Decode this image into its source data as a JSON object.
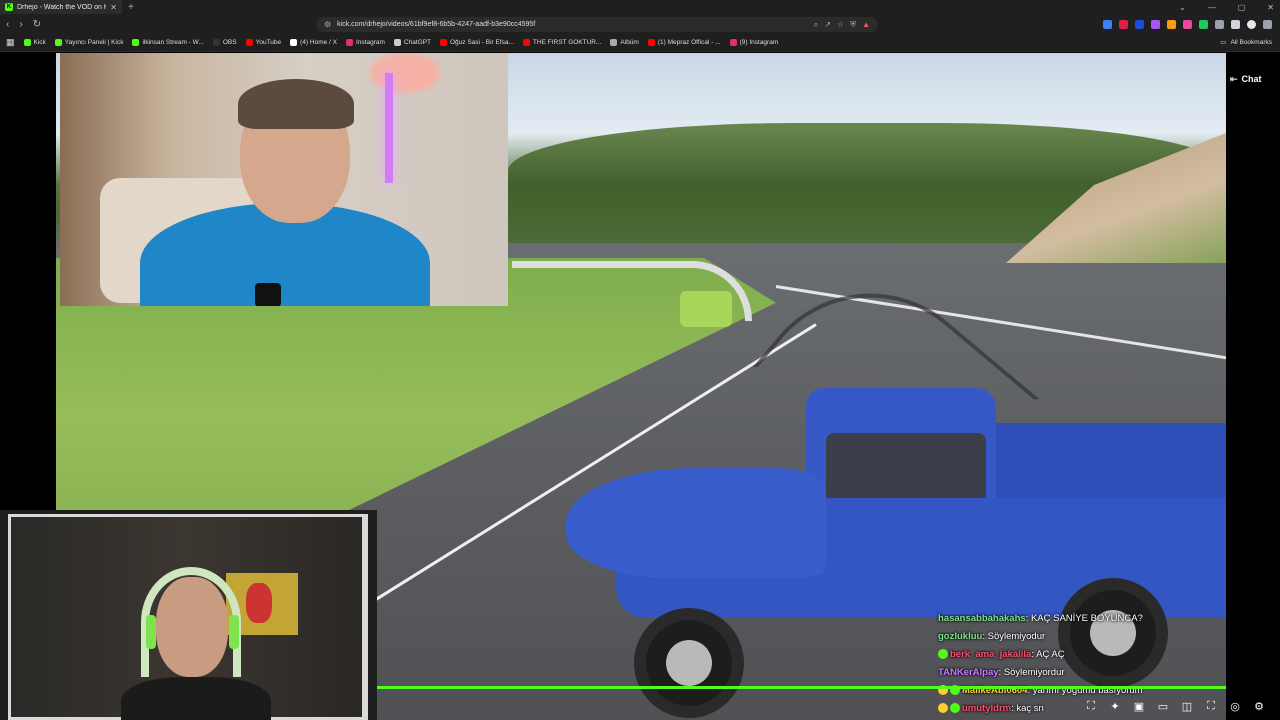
{
  "browser": {
    "tab_title": "Drhejo - Watch the VOD on Kick",
    "tab_favicon": "K",
    "url": "kick.com/drhejo/videos/61bf9ef8-6b5b-4247-aadf-b3e90cc4595f",
    "bookmarks": [
      {
        "label": "Kick",
        "color": "#53fc18"
      },
      {
        "label": "Yayıncı Paneli | Kick",
        "color": "#53fc18"
      },
      {
        "label": "ilkinsan Stream - W...",
        "color": "#53fc18"
      },
      {
        "label": "OBS",
        "color": "#333333"
      },
      {
        "label": "YouTube",
        "color": "#ff0000"
      },
      {
        "label": "(4) Home / X",
        "color": "#ffffff"
      },
      {
        "label": "Instagram",
        "color": "#e1306c"
      },
      {
        "label": "ChatGPT",
        "color": "#cccccc"
      },
      {
        "label": "Oğuz Sasi - Bir Efsa...",
        "color": "#ff0000"
      },
      {
        "label": "THE FIRST GOKTUR...",
        "color": "#ff0000"
      },
      {
        "label": "Albüm",
        "color": "#aaaaaa"
      },
      {
        "label": "(1) Mepraz Offical - ...",
        "color": "#ff0000"
      },
      {
        "label": "(9) Instagram",
        "color": "#e1306c"
      }
    ],
    "all_bookmarks_label": "All Bookmarks"
  },
  "player": {
    "chat_button_label": "Chat",
    "progress_fraction": 1.0,
    "accent": "#53fc18"
  },
  "chat": [
    {
      "user": "hasansabbahakahs",
      "user_color": "#7fe08a",
      "text": "KAÇ SANİYE BOYUNCA?",
      "badge": ""
    },
    {
      "user": "gozlukluu",
      "user_color": "#7fe08a",
      "text": "Söylemiyodur",
      "badge": ""
    },
    {
      "user": "berk_ama_jakalila",
      "user_color": "#ff4d6d",
      "text": "AÇ AÇ",
      "badge": "#53fc18"
    },
    {
      "user": "TANKerAlpay",
      "user_color": "#c77dff",
      "text": "Söylemiyordur",
      "badge": ""
    },
    {
      "user": "MalikeAbi0604",
      "user_color": "#ffcc33",
      "text": "yarımı yoğumu basıyorum",
      "badge": "#ffcc33"
    },
    {
      "user": "umutyldrm",
      "user_color": "#ff4d6d",
      "text": "kaç sn",
      "badge": "#ffcc33"
    }
  ]
}
